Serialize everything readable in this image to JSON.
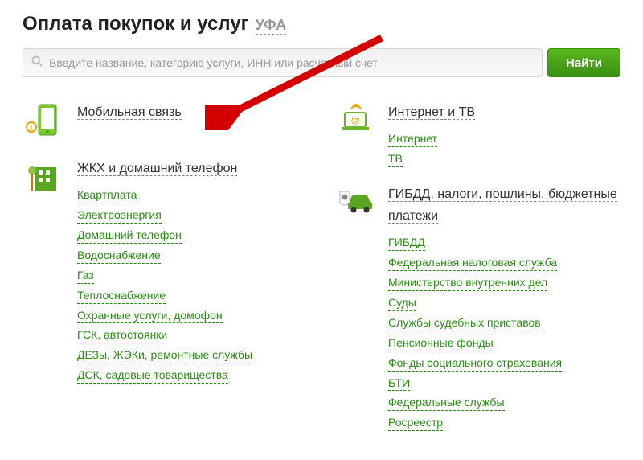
{
  "header": {
    "title": "Оплата покупок и услуг",
    "city": "УФА"
  },
  "search": {
    "placeholder": "Введите название, категорию услуги, ИНН или расчетный счет",
    "button": "Найти"
  },
  "left": [
    {
      "key": "mobile",
      "title": "Мобильная связь",
      "items": []
    },
    {
      "key": "utilities",
      "title": "ЖКХ и домашний телефон",
      "items": [
        "Квартплата",
        "Электроэнергия",
        "Домашний телефон",
        "Водоснабжение",
        "Газ",
        "Теплоснабжение",
        "Охранные услуги, домофон",
        "ГСК, автостоянки",
        "ДЕЗы, ЖЭКи, ремонтные службы",
        "ДСК, садовые товарищества"
      ]
    }
  ],
  "right": [
    {
      "key": "internet",
      "title": "Интернет и ТВ",
      "items": [
        "Интернет",
        "ТВ"
      ]
    },
    {
      "key": "gov",
      "title": "ГИБДД, налоги, пошлины, бюджетные платежи",
      "items": [
        "ГИБДД",
        "Федеральная налоговая служба",
        "Министерство внутренних дел",
        "Суды",
        "Службы судебных приставов",
        "Пенсионные фонды",
        "Фонды социального страхования",
        "БТИ",
        "Федеральные службы",
        "Росреестр"
      ]
    }
  ]
}
